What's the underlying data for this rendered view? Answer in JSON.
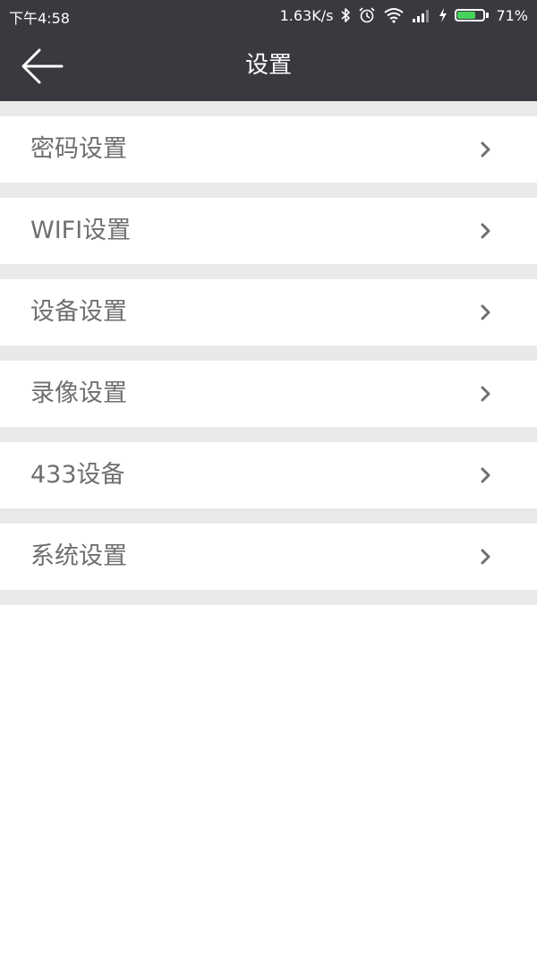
{
  "status_bar": {
    "time": "下午4:58",
    "net_speed": "1.63K/s",
    "battery_pct": "71%",
    "battery_level": 71,
    "icons": [
      "bluetooth-icon",
      "alarm-icon",
      "wifi-icon",
      "signal-icon",
      "charging-icon",
      "battery-icon"
    ]
  },
  "header": {
    "title": "设置",
    "back_icon": "arrow-left-icon"
  },
  "menu": {
    "items": [
      {
        "label": "密码设置"
      },
      {
        "label": "WIFI设置"
      },
      {
        "label": "设备设置"
      },
      {
        "label": "录像设置"
      },
      {
        "label": "433设备"
      },
      {
        "label": "系统设置"
      }
    ],
    "chevron_icon": "chevron-right-icon"
  },
  "colors": {
    "header_bg": "#393a3f",
    "divider_bg": "#e9e9e9",
    "label_text": "#6f6f6f",
    "battery_fill": "#46d35a"
  }
}
